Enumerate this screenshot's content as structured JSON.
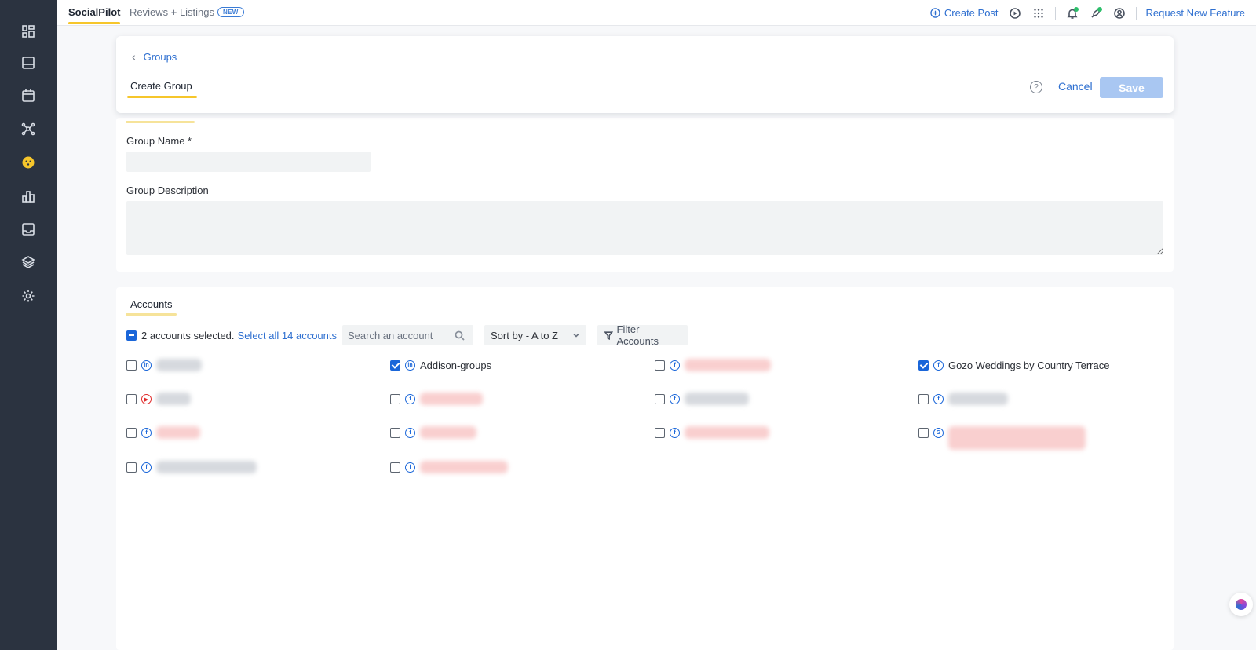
{
  "topbar": {
    "tabs": [
      {
        "label": "SocialPilot"
      },
      {
        "label": "Reviews + Listings",
        "badge": "NEW"
      }
    ],
    "create_post": "Create Post",
    "request_feature": "Request New Feature"
  },
  "header": {
    "back_label": "Groups",
    "title": "Create Group",
    "cancel_label": "Cancel",
    "save_label": "Save"
  },
  "form": {
    "group_name_label": "Group Name *",
    "group_name_value": "",
    "group_description_label": "Group Description",
    "group_description_value": ""
  },
  "accounts": {
    "tab_label": "Accounts",
    "selected_text": "2 accounts selected.",
    "select_all_text": "Select all 14 accounts",
    "search_placeholder": "Search an account",
    "sort_label": "Sort by - A to Z",
    "filter_label": "Filter Accounts",
    "items": [
      {
        "name": "",
        "network": "linkedin",
        "checked": false
      },
      {
        "name": "Addison-groups",
        "network": "linkedin",
        "checked": true
      },
      {
        "name": "",
        "network": "facebook",
        "checked": false
      },
      {
        "name": "Gozo Weddings by Country Terrace",
        "network": "facebook",
        "checked": true
      },
      {
        "name": "",
        "network": "youtube",
        "checked": false
      },
      {
        "name": "",
        "network": "facebook",
        "checked": false
      },
      {
        "name": "",
        "network": "facebook",
        "checked": false
      },
      {
        "name": "",
        "network": "facebook",
        "checked": false
      },
      {
        "name": "",
        "network": "facebook",
        "checked": false
      },
      {
        "name": "",
        "network": "facebook",
        "checked": false
      },
      {
        "name": "",
        "network": "facebook",
        "checked": false
      },
      {
        "name": "",
        "network": "google",
        "checked": false
      },
      {
        "name": "",
        "network": "facebook",
        "checked": false
      },
      {
        "name": "",
        "network": "facebook",
        "checked": false
      }
    ]
  },
  "colors": {
    "rail": "#2b3340",
    "accent": "#2e6fd0",
    "highlight": "#f6c62b",
    "save_disabled": "#a9c7f2"
  }
}
